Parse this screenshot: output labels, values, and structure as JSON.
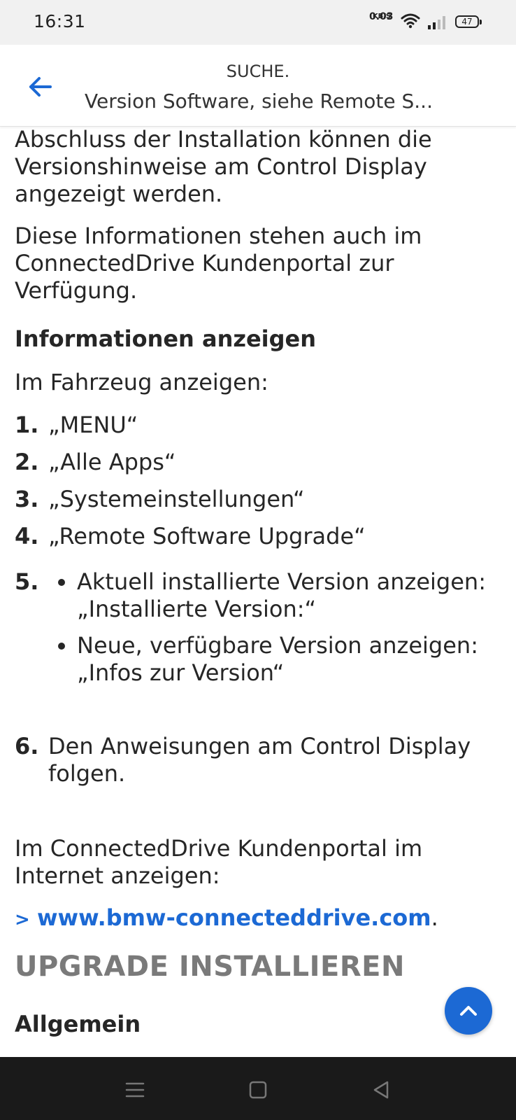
{
  "status_bar": {
    "time": "16:31",
    "net_speed_value": "0.03",
    "net_speed_unit": "KB/S",
    "battery": "47",
    "icons": [
      "wifi-icon",
      "signal-icon",
      "battery-icon"
    ]
  },
  "header": {
    "subtitle": "SUCHE.",
    "title": "Version Software, siehe Remote S..."
  },
  "content": {
    "intro_paragraph_lines": [
      "Abschluss der Installation können die",
      "Versionshinweise am Control Display",
      "angezeigt werden."
    ],
    "portal_paragraph_lines": [
      "Diese Informationen stehen auch im",
      "ConnectedDrive Kundenportal zur",
      "Verfügung."
    ],
    "info_heading": "Informationen anzeigen",
    "in_vehicle_label": "Im Fahrzeug anzeigen:",
    "steps": [
      {
        "number": "1.",
        "text": "„MENU“"
      },
      {
        "number": "2.",
        "text": "„Alle Apps“"
      },
      {
        "number": "3.",
        "text": "„Systemeinstellungen“"
      },
      {
        "number": "4.",
        "text": "„Remote Software Upgrade“"
      }
    ],
    "step5": {
      "number": "5.",
      "bullets": [
        {
          "line1": "Aktuell installierte Version anzeigen:",
          "line2": "„Installierte Version:“"
        },
        {
          "line1": "Neue, verfügbare Version anzeigen:",
          "line2": "„Infos zur Version“"
        }
      ]
    },
    "step6": {
      "number": "6.",
      "line1": "Den Anweisungen am Control Display",
      "line2": "folgen."
    },
    "internet_lines": [
      "Im ConnectedDrive Kundenportal im",
      "Internet anzeigen:"
    ],
    "link_arrow": ">",
    "link_text": "www.bmw-connecteddrive.com",
    "link_suffix": ".",
    "section_heading": "UPGRADE INSTALLIEREN",
    "sub_heading": "Allgemein"
  },
  "colors": {
    "accent": "#1c69d4",
    "text": "#262626",
    "section_heading": "#7a7a7a",
    "status_bar_bg": "#f1f1f1",
    "nav_bar_bg": "#1a1a1a"
  }
}
